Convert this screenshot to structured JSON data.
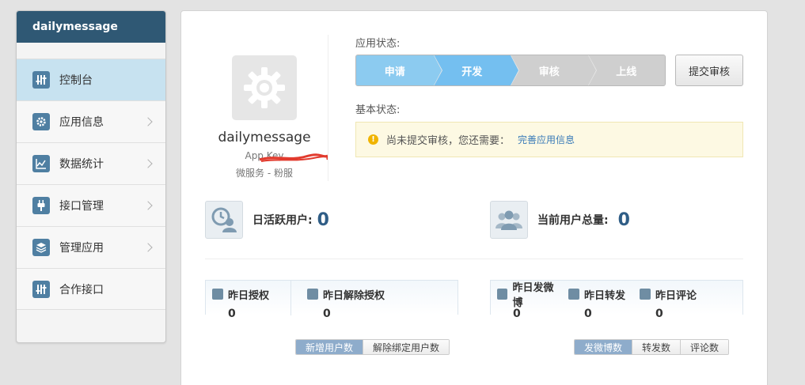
{
  "sidebar": {
    "title": "dailymessage",
    "items": [
      {
        "label": "控制台",
        "icon": "sliders-icon",
        "active": true
      },
      {
        "label": "应用信息",
        "icon": "gear-icon"
      },
      {
        "label": "数据统计",
        "icon": "chart-icon"
      },
      {
        "label": "接口管理",
        "icon": "plug-icon"
      },
      {
        "label": "管理应用",
        "icon": "layers-icon"
      },
      {
        "label": "合作接口",
        "icon": "sliders-icon"
      }
    ]
  },
  "app": {
    "name": "dailymessage",
    "key_label": "App Key",
    "type": "微服务 - 粉服"
  },
  "status": {
    "app_status_label": "应用状态:",
    "steps": [
      "申请",
      "开发",
      "审核",
      "上线"
    ],
    "submit_button": "提交审核",
    "basic_status_label": "基本状态:",
    "notice_text": "尚未提交审核，您还需要：",
    "notice_link": "完善应用信息"
  },
  "stats": {
    "daily_active_label": "日活跃用户:",
    "daily_active_value": "0",
    "total_users_label": "当前用户总量:",
    "total_users_value": "0"
  },
  "metrics_left": [
    {
      "label": "昨日授权",
      "value": "0"
    },
    {
      "label": "昨日解除授权",
      "value": "0"
    }
  ],
  "metrics_right": [
    {
      "label": "昨日发微博",
      "value": "0"
    },
    {
      "label": "昨日转发",
      "value": "0"
    },
    {
      "label": "昨日评论",
      "value": "0"
    }
  ],
  "tabs_left": [
    "新增用户数",
    "解除绑定用户数"
  ],
  "tabs_right": [
    "发微博数",
    "转发数",
    "评论数"
  ],
  "colors": {
    "sidebar_header": "#2f5874",
    "active_item": "#c7e2f0",
    "accent_number": "#2f5d86",
    "step_active": "#74bff0"
  }
}
